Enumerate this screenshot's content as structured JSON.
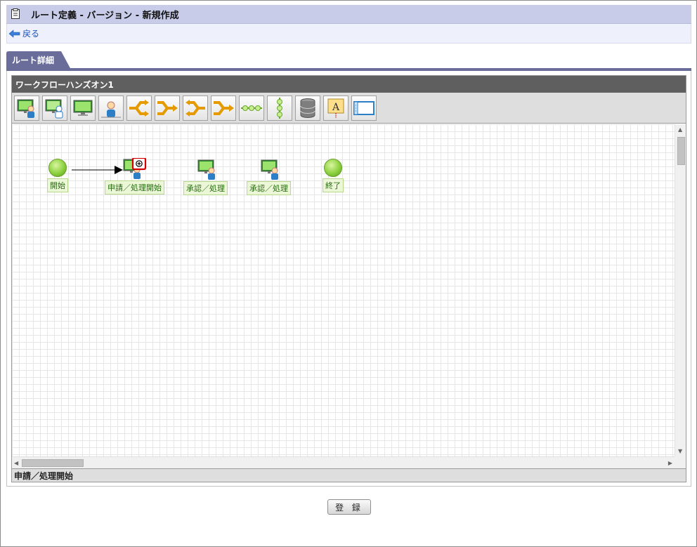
{
  "header": {
    "title": "ルート定義 - バージョン - 新規作成",
    "icon": "document-icon"
  },
  "back": {
    "label": "戻る",
    "icon": "back-arrow-icon"
  },
  "tab": {
    "label": "ルート詳細"
  },
  "editor": {
    "title": "ワークフローハンズオン1",
    "toolbar": [
      "approval-node-icon",
      "approval-node-alt-icon",
      "process-node-icon",
      "user-node-icon",
      "branch-icon",
      "merge-icon",
      "branch-back-icon",
      "merge-back-icon",
      "horizontal-line-icon",
      "vertical-line-icon",
      "database-icon",
      "text-annotation-icon",
      "container-icon"
    ],
    "nodes": {
      "start": "開始",
      "apply": "申請／処理開始",
      "approve1": "承認／処理",
      "approve2": "承認／処理",
      "end": "終了"
    },
    "status": "申請／処理開始"
  },
  "footer": {
    "register_label": "登 録"
  },
  "colors": {
    "title_bar": "#c8cce8",
    "tab": "#6a6d9a",
    "node_label_text": "#276b11",
    "highlight": "#d40000"
  }
}
